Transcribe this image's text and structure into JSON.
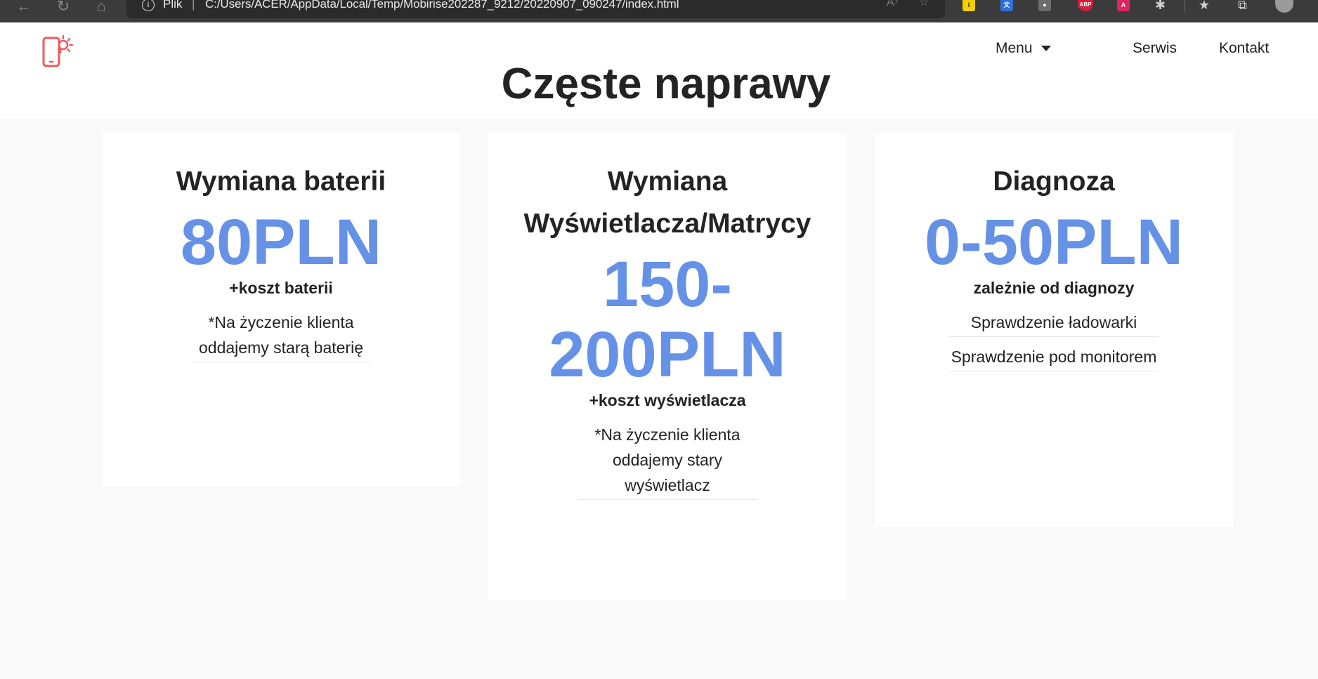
{
  "browser": {
    "address_label": "Plik",
    "separator": "|",
    "url": "C:/Users/ACER/AppData/Local/Temp/Mobirise202287_9212/20220907_090247/index.html",
    "extensions": [
      {
        "name": "ext-i-icon",
        "text": "i",
        "color": "#f5d000"
      },
      {
        "name": "translate-icon",
        "text": "文A",
        "color": "#2f6fd6"
      },
      {
        "name": "ext-bulb-icon",
        "text": "●",
        "color": "#6d6d6d"
      },
      {
        "name": "adblock-icon",
        "text": "ABP",
        "color": "#d61f3b"
      },
      {
        "name": "ext-pink-icon",
        "text": "A",
        "color": "#e0245e"
      }
    ]
  },
  "header": {
    "title": "Częste naprawy",
    "nav": {
      "menu": "Menu",
      "serwis": "Serwis",
      "kontakt": "Kontakt"
    }
  },
  "accent_color": "#6592e6",
  "cards": [
    {
      "title": "Wymiana baterii",
      "price": "80PLN",
      "subtitle": "+koszt baterii",
      "items": [
        "*Na życzenie klienta oddajemy starą baterię"
      ]
    },
    {
      "title": "Wymiana Wyświetlacza/Matrycy",
      "price": "150-200PLN",
      "subtitle": "+koszt wyświetlacza",
      "items": [
        "*Na życzenie klienta oddajemy stary wyświetlacz"
      ]
    },
    {
      "title": "Diagnoza",
      "price": "0-50PLN",
      "subtitle": "zależnie od diagnozy",
      "items": [
        "Sprawdzenie ładowarki",
        "Sprawdzenie pod monitorem"
      ]
    }
  ]
}
